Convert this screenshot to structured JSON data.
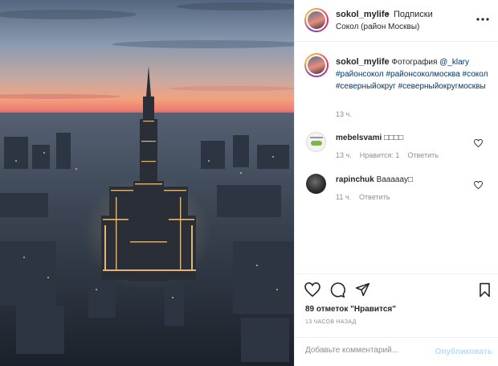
{
  "header": {
    "username": "sokol_mylife",
    "separator": "•",
    "follow_label": "Подписки",
    "location": "Сокол (район Москвы)",
    "more_icon": "more-horizontal-icon"
  },
  "caption": {
    "username": "sokol_mylife",
    "text_before": " Фотография ",
    "mention": "@_klary",
    "hashtags": [
      "#районсокол",
      "#районсоколмосква",
      "#сокол",
      "#северныйокруг",
      "#северныйокругмосквы"
    ],
    "time": "13 ч."
  },
  "comments": [
    {
      "username": "mebelsvami",
      "text": " □□□□",
      "time": "13 ч.",
      "likes": "Нравится: 1",
      "reply": "Ответить"
    },
    {
      "username": "rapinchuk",
      "text": " Вааааау□",
      "time": "11 ч.",
      "reply": "Ответить"
    }
  ],
  "actions": {
    "icons": [
      "heart-icon",
      "comment-icon",
      "share-icon",
      "bookmark-icon"
    ],
    "likes": "89 отметок \"Нравится\"",
    "posted": "13 ЧАСОВ НАЗАД"
  },
  "add_comment": {
    "placeholder": "Добавьте комментарий...",
    "publish_label": "Опубликовать",
    "publish_color": "#b2dffc"
  },
  "colors": {
    "link": "#00376b",
    "secondary": "#8e8e8e",
    "sky_top": "#6f86a8",
    "sky_glow": "#f08a6e"
  }
}
